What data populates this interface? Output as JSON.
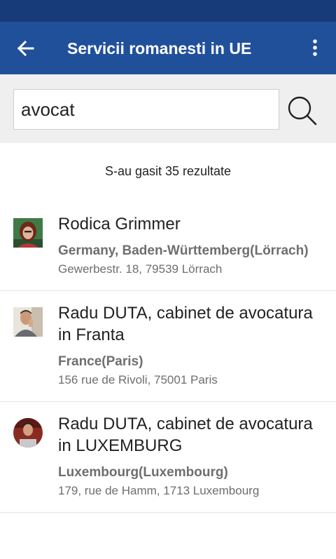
{
  "app_bar": {
    "title": "Servicii romanesti in UE",
    "back_icon": "arrow-left-icon",
    "menu_icon": "more-vert-icon",
    "background": "#21509b",
    "status_background": "#173a78"
  },
  "search": {
    "value": "avocat",
    "button_icon": "search-icon"
  },
  "result_count": "S-au gasit 35 rezultate",
  "results": [
    {
      "name": "Rodica Grimmer",
      "location": "Germany, Baden-Württemberg(Lörrach)",
      "address": "Gewerbestr. 18, 79539 Lörrach"
    },
    {
      "name": "Radu DUTA, cabinet de avocatura in Franta",
      "location": "France(Paris)",
      "address": "156 rue de Rivoli, 75001 Paris"
    },
    {
      "name": "Radu DUTA, cabinet de avocatura in LUXEMBURG",
      "location": "Luxembourg(Luxembourg)",
      "address": "179, rue de Hamm, 1713 Luxembourg"
    }
  ]
}
